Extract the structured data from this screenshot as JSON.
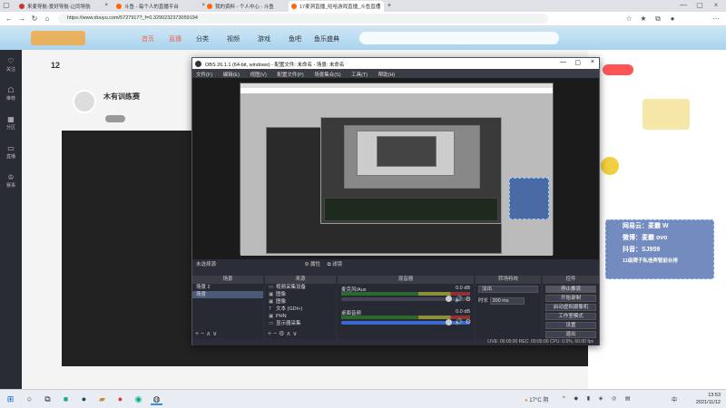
{
  "browser": {
    "tabs": [
      {
        "label": "来麦导航-爱好导航-让同导航",
        "active": false
      },
      {
        "label": "斗鱼 - 每个人的直播平台",
        "active": false
      },
      {
        "label": "我的资料 - 个人中心 - 斗鱼",
        "active": false
      },
      {
        "label": "17麦洞直播_哈哈游戏直播_斗鱼直播",
        "active": true
      }
    ],
    "url": "https://www.douyu.com/5727917?_f=0.3290232373059194"
  },
  "site": {
    "nav": [
      "首页",
      "直播",
      "分类",
      "视频",
      "游戏",
      "鱼吧",
      "鱼乐盛典"
    ],
    "sidebar": [
      "关注",
      "推荐",
      "分区",
      "直播",
      "赛事"
    ],
    "room": {
      "title": "木有训练赛",
      "follow_count": "12"
    }
  },
  "obs": {
    "title": "OBS 26.1.1 (64-bit, windows) - 配置文件: 未命名 - 场景: 未命名",
    "menu": [
      "文件(F)",
      "编辑(E)",
      "视图(V)",
      "配置文件(P)",
      "场景集合(S)",
      "工具(T)",
      "帮助(H)"
    ],
    "no_source_label": "未选择源",
    "props_label": "属性",
    "filters_label": "滤镜",
    "scenes_header": "场景",
    "scenes": [
      "场景 2",
      "场景"
    ],
    "sources_header": "来源",
    "sources": [
      "视频采集设备",
      "图像",
      "图像",
      "文本 (GDI+)",
      "PHN",
      "显示器采集"
    ],
    "mixer_header": "混音器",
    "mixer": [
      {
        "name": "麦克风/Aux",
        "db": "0.0 dB"
      },
      {
        "name": "桌面音频",
        "db": "0.0 dB"
      }
    ],
    "transitions_header": "转场特效",
    "transition_value": "淡出",
    "duration_label": "时长",
    "duration_value": "300 ms",
    "controls_header": "控件",
    "controls": [
      "停止推流",
      "开始录制",
      "启动虚拟摄像机",
      "工作室模式",
      "设置",
      "退出"
    ],
    "status": "LIVE: 00:00:00   REC: 00:00:00   CPU: 0.9%, 60.00 fps"
  },
  "overlay": {
    "lines": [
      "网易云：麦霸 W",
      "微博：麦霸 ovo",
      "抖音：SJ959",
      "11级牌子私信弄管前台排"
    ]
  },
  "taskbar": {
    "weather": "17°C 阴",
    "time": "13:53",
    "date": "2021/11/12",
    "lang": "中"
  }
}
